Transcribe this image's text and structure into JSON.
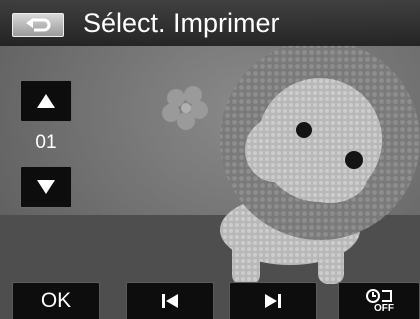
{
  "header": {
    "title": "Sélect. Imprimer",
    "back_icon": "return-arrow-icon"
  },
  "controls": {
    "up_icon": "triangle-up-icon",
    "down_icon": "triangle-down-icon",
    "quantity": "01"
  },
  "footer": {
    "ok_label": "OK",
    "prev_icon": "skip-previous-icon",
    "next_icon": "skip-next-icon",
    "timer_icon": "self-timer-off-icon",
    "timer_off_label": "OFF"
  },
  "colors": {
    "titlebar": "#2b2b2b",
    "button_bg": "#0d0d0d",
    "text": "#ffffff"
  }
}
